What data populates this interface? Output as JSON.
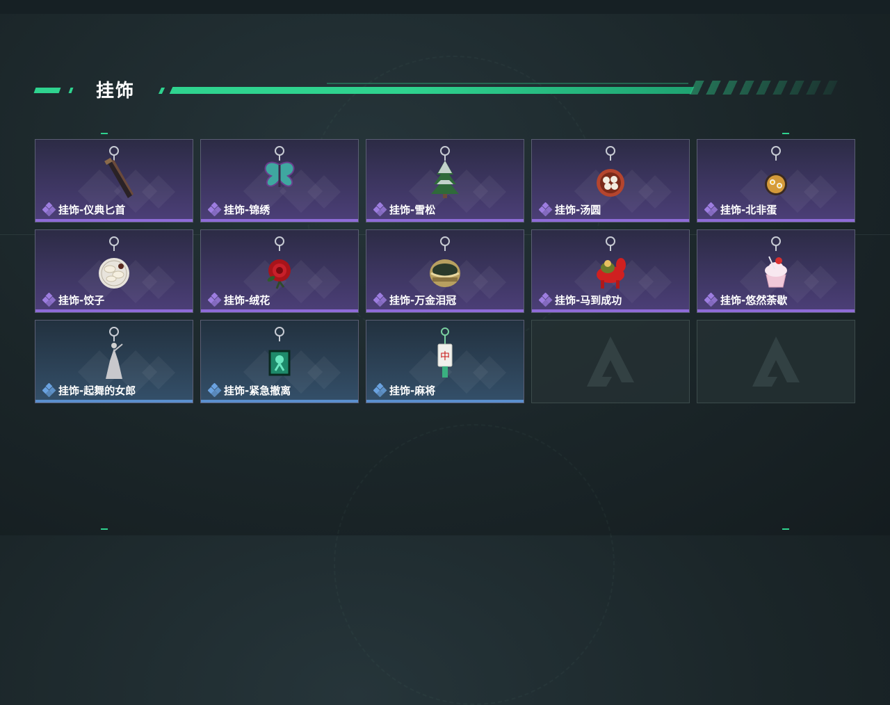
{
  "section": {
    "title": "挂饰"
  },
  "colors": {
    "accent": "#2fd38f",
    "rarity_purple": "#8e6bd8",
    "rarity_blue": "#5b90cf"
  },
  "items": [
    {
      "name": "挂饰-仪典匕首",
      "rarity": "purple",
      "icon": "ceremonial-dagger-charm"
    },
    {
      "name": "挂饰-锦绣",
      "rarity": "purple",
      "icon": "butterfly-charm"
    },
    {
      "name": "挂饰-雪松",
      "rarity": "purple",
      "icon": "snow-pine-charm"
    },
    {
      "name": "挂饰-汤圆",
      "rarity": "purple",
      "icon": "tangyuan-bowl-charm"
    },
    {
      "name": "挂饰-北非蛋",
      "rarity": "purple",
      "icon": "shakshuka-charm"
    },
    {
      "name": "挂饰-饺子",
      "rarity": "purple",
      "icon": "dumpling-plate-charm"
    },
    {
      "name": "挂饰-绒花",
      "rarity": "purple",
      "icon": "red-flower-charm"
    },
    {
      "name": "挂饰-万金泪冠",
      "rarity": "purple",
      "icon": "golden-crown-charm"
    },
    {
      "name": "挂饰-马到成功",
      "rarity": "purple",
      "icon": "red-horse-charm"
    },
    {
      "name": "挂饰-悠然荼歇",
      "rarity": "purple",
      "icon": "cupcake-charm"
    },
    {
      "name": "挂饰-起舞的女郎",
      "rarity": "blue",
      "icon": "dancing-lady-charm"
    },
    {
      "name": "挂饰-紧急撤离",
      "rarity": "blue",
      "icon": "emergency-exit-charm"
    },
    {
      "name": "挂饰-麻将",
      "rarity": "blue",
      "icon": "mahjong-tile-charm"
    }
  ],
  "empty_slots": [
    {
      "icon": "game-logo-placeholder"
    },
    {
      "icon": "game-logo-placeholder"
    }
  ]
}
